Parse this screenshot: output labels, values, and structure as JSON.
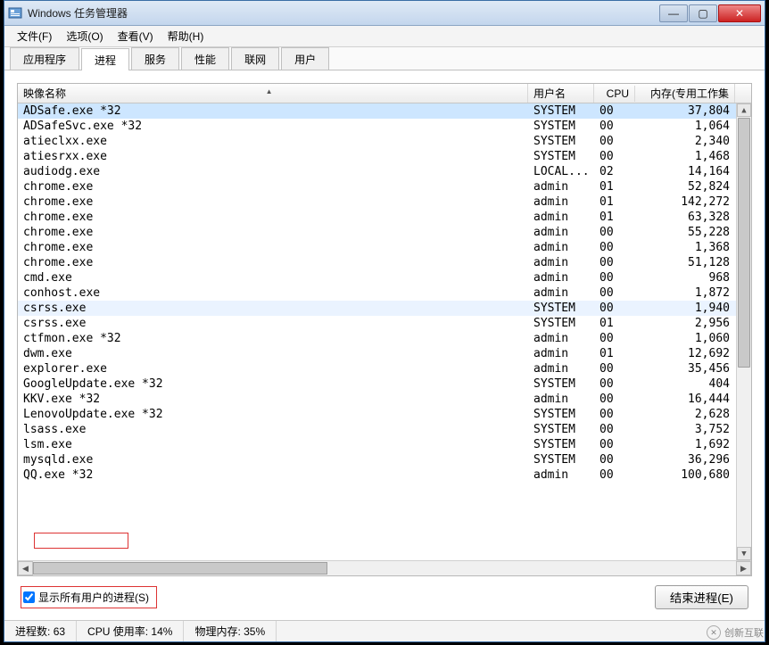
{
  "window": {
    "title": "Windows 任务管理器"
  },
  "winbtns": {
    "min": "—",
    "max": "▢",
    "close": "✕"
  },
  "menubar": [
    "文件(F)",
    "选项(O)",
    "查看(V)",
    "帮助(H)"
  ],
  "tabs": {
    "items": [
      "应用程序",
      "进程",
      "服务",
      "性能",
      "联网",
      "用户"
    ],
    "active_index": 1
  },
  "columns": {
    "name": "映像名称",
    "user": "用户名",
    "cpu": "CPU",
    "mem": "内存(专用工作集"
  },
  "processes": [
    {
      "name": "ADSafe.exe *32",
      "user": "SYSTEM",
      "cpu": "00",
      "mem": "37,804",
      "sel": true
    },
    {
      "name": "ADSafeSvc.exe *32",
      "user": "SYSTEM",
      "cpu": "00",
      "mem": "1,064"
    },
    {
      "name": "atieclxx.exe",
      "user": "SYSTEM",
      "cpu": "00",
      "mem": "2,340"
    },
    {
      "name": "atiesrxx.exe",
      "user": "SYSTEM",
      "cpu": "00",
      "mem": "1,468"
    },
    {
      "name": "audiodg.exe",
      "user": "LOCAL...",
      "cpu": "02",
      "mem": "14,164"
    },
    {
      "name": "chrome.exe",
      "user": "admin",
      "cpu": "01",
      "mem": "52,824"
    },
    {
      "name": "chrome.exe",
      "user": "admin",
      "cpu": "01",
      "mem": "142,272"
    },
    {
      "name": "chrome.exe",
      "user": "admin",
      "cpu": "01",
      "mem": "63,328"
    },
    {
      "name": "chrome.exe",
      "user": "admin",
      "cpu": "00",
      "mem": "55,228"
    },
    {
      "name": "chrome.exe",
      "user": "admin",
      "cpu": "00",
      "mem": "1,368"
    },
    {
      "name": "chrome.exe",
      "user": "admin",
      "cpu": "00",
      "mem": "51,128"
    },
    {
      "name": "cmd.exe",
      "user": "admin",
      "cpu": "00",
      "mem": "968"
    },
    {
      "name": "conhost.exe",
      "user": "admin",
      "cpu": "00",
      "mem": "1,872"
    },
    {
      "name": "csrss.exe",
      "user": "SYSTEM",
      "cpu": "00",
      "mem": "1,940",
      "hover": true
    },
    {
      "name": "csrss.exe",
      "user": "SYSTEM",
      "cpu": "01",
      "mem": "2,956"
    },
    {
      "name": "ctfmon.exe *32",
      "user": "admin",
      "cpu": "00",
      "mem": "1,060"
    },
    {
      "name": "dwm.exe",
      "user": "admin",
      "cpu": "01",
      "mem": "12,692"
    },
    {
      "name": "explorer.exe",
      "user": "admin",
      "cpu": "00",
      "mem": "35,456"
    },
    {
      "name": "GoogleUpdate.exe *32",
      "user": "SYSTEM",
      "cpu": "00",
      "mem": "404"
    },
    {
      "name": "KKV.exe *32",
      "user": "admin",
      "cpu": "00",
      "mem": "16,444"
    },
    {
      "name": "LenovoUpdate.exe *32",
      "user": "SYSTEM",
      "cpu": "00",
      "mem": "2,628"
    },
    {
      "name": "lsass.exe",
      "user": "SYSTEM",
      "cpu": "00",
      "mem": "3,752"
    },
    {
      "name": "lsm.exe",
      "user": "SYSTEM",
      "cpu": "00",
      "mem": "1,692"
    },
    {
      "name": "mysqld.exe",
      "user": "SYSTEM",
      "cpu": "00",
      "mem": "36,296"
    },
    {
      "name": "QQ.exe *32",
      "user": "admin",
      "cpu": "00",
      "mem": "100,680"
    }
  ],
  "bottom": {
    "show_all_label": "显示所有用户的进程(S)",
    "show_all_checked": true,
    "end_process_label": "结束进程(E)"
  },
  "status": {
    "count_label": "进程数:",
    "count_value": "63",
    "cpu_label": "CPU 使用率:",
    "cpu_value": "14%",
    "mem_label": "物理内存:",
    "mem_value": "35%"
  },
  "watermark": "创新互联"
}
